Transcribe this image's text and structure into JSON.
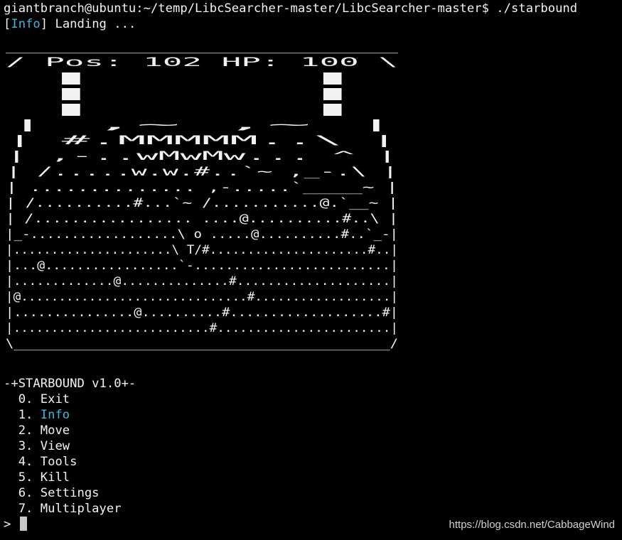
{
  "terminal": {
    "command_line": "giantbranch@ubuntu:~/temp/LibcSearcher-master/LibcSearcher-master$ ./starbound",
    "status": {
      "open_bracket": "[",
      "tag": "Info",
      "close_bracket": "]",
      "message": " Landing ..."
    },
    "art_lines": [
      "  _______________________________________________",
      " / Pos: 102 HP: 100                              \\",
      "|                                                  |",
      "|                                                  |",
      "|                                                  |",
      "|       ,~      ,~                                 |",
      "|       #.MMMMM..\\                                 |",
      "|     ,-..wMwMw...                ^               |",
      "|    /.....w.w.#..`~           ,_-.\\             |",
      "|    ..............           ,-.....`_____~       |",
      "|   /..........#...`~     /...........@.`__~       |",
      "|  /.................      ....@..........#..\\     |",
      "|_-..................\\  o .....@..........#..`_-|",
      "|.....................\\ T/#.....................#..|",
      "|...@.................`-.........................|",
      "|.............@..............#....................|",
      "|@..............................#..................|",
      "|...............@..........#...................#|",
      "|..........................#.......................|",
      " \\_______________________________________________/"
    ],
    "menu": {
      "title": "-+STARBOUND v1.0+-",
      "items": [
        {
          "num": "  0. ",
          "label": "Exit"
        },
        {
          "num": "  1. ",
          "label": "Info"
        },
        {
          "num": "  2. ",
          "label": "Move"
        },
        {
          "num": "  3. ",
          "label": "View"
        },
        {
          "num": "  4. ",
          "label": "Tools"
        },
        {
          "num": "  5. ",
          "label": "Kill"
        },
        {
          "num": "  6. ",
          "label": "Settings"
        },
        {
          "num": "  7. ",
          "label": "Multiplayer"
        }
      ]
    },
    "prompt": "> ",
    "colors": {
      "background": "#000000",
      "foreground": "#f2f2f2",
      "highlight": "#3fb6de"
    }
  },
  "watermark": "https://blog.csdn.net/CabbageWind"
}
